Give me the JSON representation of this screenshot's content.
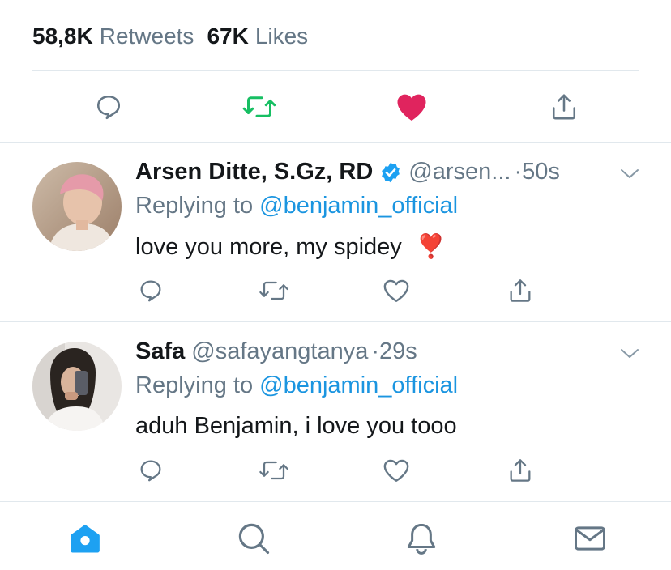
{
  "stats": {
    "retweets_count": "58,8K",
    "retweets_label": "Retweets",
    "likes_count": "67K",
    "likes_label": "Likes"
  },
  "tweet_actions": {
    "reply_icon": "reply-icon",
    "retweet_icon": "retweet-icon",
    "like_icon": "heart-filled-icon",
    "share_icon": "share-icon",
    "retweet_color": "#17bf63",
    "like_color": "#e0245e"
  },
  "replies": [
    {
      "name": "Arsen Ditte, S.Gz, RD",
      "verified": true,
      "handle": "@arsen...",
      "separator": "·",
      "time": "50s",
      "replying_prefix": "Replying to",
      "replying_to": "@benjamin_official",
      "text": "love you more, my spidey",
      "emoji": "❣️"
    },
    {
      "name": "Safa",
      "verified": false,
      "handle": "@safayangtanya",
      "separator": "·",
      "time": "29s",
      "replying_prefix": "Replying to",
      "replying_to": "@benjamin_official",
      "text": "aduh Benjamin, i love you tooo"
    }
  ],
  "tabbar": {
    "items": [
      "home-icon",
      "search-icon",
      "notifications-icon",
      "messages-icon"
    ],
    "active": "home-icon",
    "accent": "#1da1f2",
    "inactive": "#657786"
  }
}
